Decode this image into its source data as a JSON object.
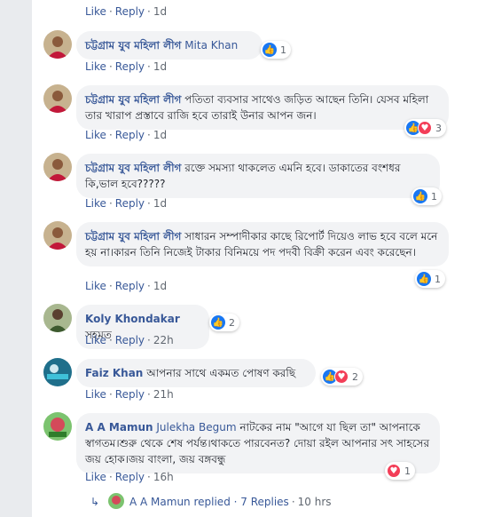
{
  "action_like": "Like",
  "action_reply": "Reply",
  "comments": [
    {
      "time": "1d"
    },
    {
      "author": "চট্টগ্রাম যুব মহিলা লীগ",
      "text_tag": "Mita Khan",
      "time": "1d",
      "reactions": "1"
    },
    {
      "author": "চট্টগ্রাম যুব মহিলা লীগ",
      "text": "পতিতা ব্যবসার সাথেও জড়িত আছেন তিনি। যেসব মহিলা তার খারাপ প্রস্তাবে রাজি হবে তারাই উনার আপন জন।",
      "time": "1d",
      "reactions": "3"
    },
    {
      "author": "চট্টগ্রাম যুব মহিলা লীগ",
      "text": "রক্তে সমস্যা থাকলেত এমনি হবে। ডাকাতের বংশধর কি,ভাল হবে?????",
      "time": "1d",
      "reactions": "1"
    },
    {
      "author": "চট্টগ্রাম যুব মহিলা লীগ",
      "text": "সাধারন সম্পাদীকার কাছে রিপোর্ট দিয়েও লাভ হবে বলে মনে হয় না।কারন তিনি নিজেই টাকার বিনিময়ে পদ পদবী বিক্রী করেন এবং করেছেন।",
      "time": "1d",
      "reactions": "1"
    },
    {
      "author": "Koly Khondakar",
      "text": "সহমত",
      "time": "22h",
      "reactions": "2"
    },
    {
      "author": "Faiz Khan",
      "text": "আপনার সাথে একমত পোষণ করছি",
      "time": "21h",
      "reactions": "2"
    },
    {
      "author": "A A Mamun",
      "text_tag": "Julekha Begum",
      "text": "নাটকের নাম \"আগে যা ছিল তা\" আপনাকে স্বাগতম।শুরু থেকে শেষ পর্যন্ত।থাকতে পারবেনত? দোয়া রইল আপনার সৎ সাহসের জয় হোক।জয় বাংলা, জয় বঙ্গবন্ধু",
      "time": "16h",
      "reactions": "1"
    }
  ],
  "replies": {
    "text": "A A Mamun replied · 7 Replies",
    "time": "10 hrs"
  },
  "colors": {
    "link": "#385898",
    "like": "#1877f2",
    "love": "#f33e58",
    "bubble": "#f2f3f5"
  }
}
